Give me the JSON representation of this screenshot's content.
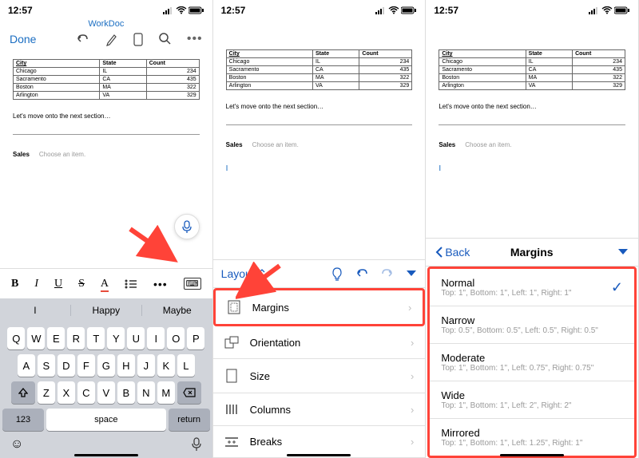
{
  "status": {
    "time": "12:57"
  },
  "header": {
    "doc_title": "WorkDoc",
    "done": "Done"
  },
  "table": {
    "headers": [
      "City",
      "State",
      "Count"
    ],
    "rows": [
      [
        "Chicago",
        "IL",
        "234"
      ],
      [
        "Sacramento",
        "CA",
        "435"
      ],
      [
        "Boston",
        "MA",
        "322"
      ],
      [
        "Arlington",
        "VA",
        "329"
      ]
    ]
  },
  "body_text": "Let's move onto the next section…",
  "sales": {
    "label": "Sales",
    "placeholder": "Choose an item."
  },
  "suggestions": [
    "I",
    "Happy",
    "Maybe"
  ],
  "keyboard_rows": {
    "r1": [
      "Q",
      "W",
      "E",
      "R",
      "T",
      "Y",
      "U",
      "I",
      "O",
      "P"
    ],
    "r2": [
      "A",
      "S",
      "D",
      "F",
      "G",
      "H",
      "J",
      "K",
      "L"
    ],
    "r3": [
      "Z",
      "X",
      "C",
      "V",
      "B",
      "N",
      "M"
    ]
  },
  "keyboard_funcs": {
    "numbers": "123",
    "space": "space",
    "return": "return"
  },
  "ribbon": {
    "tab": "Layout",
    "items": [
      {
        "label": "Margins",
        "icon": "margins"
      },
      {
        "label": "Orientation",
        "icon": "orientation"
      },
      {
        "label": "Size",
        "icon": "size"
      },
      {
        "label": "Columns",
        "icon": "columns"
      },
      {
        "label": "Breaks",
        "icon": "breaks"
      }
    ]
  },
  "margins_nav": {
    "back": "Back",
    "title": "Margins"
  },
  "margin_options": [
    {
      "name": "Normal",
      "detail": "Top: 1\", Bottom: 1\", Left: 1\", Right: 1\"",
      "checked": true
    },
    {
      "name": "Narrow",
      "detail": "Top: 0.5\", Bottom: 0.5\", Left: 0.5\", Right: 0.5\""
    },
    {
      "name": "Moderate",
      "detail": "Top: 1\", Bottom: 1\", Left: 0.75\", Right: 0.75\""
    },
    {
      "name": "Wide",
      "detail": "Top: 1\", Bottom: 1\", Left: 2\", Right: 2\""
    },
    {
      "name": "Mirrored",
      "detail": "Top: 1\", Bottom: 1\", Left: 1.25\", Right: 1\""
    }
  ]
}
